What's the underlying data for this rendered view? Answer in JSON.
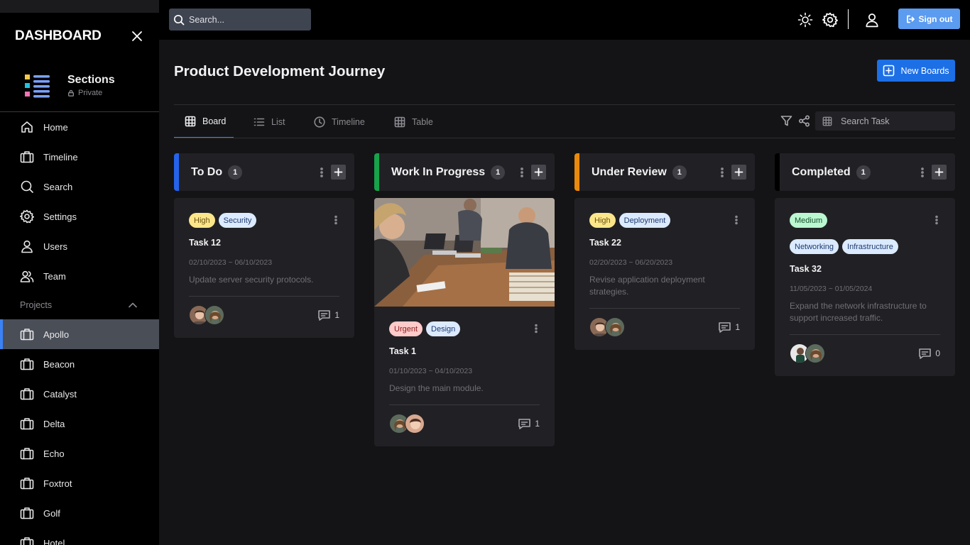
{
  "sidebar": {
    "title": "DASHBOARD",
    "section": {
      "title": "Sections",
      "visibility": "Private"
    },
    "nav": [
      {
        "label": "Home",
        "icon": "home-icon"
      },
      {
        "label": "Timeline",
        "icon": "briefcase-icon"
      },
      {
        "label": "Search",
        "icon": "search-icon"
      },
      {
        "label": "Settings",
        "icon": "gear-icon"
      },
      {
        "label": "Users",
        "icon": "user-icon"
      },
      {
        "label": "Team",
        "icon": "team-icon"
      }
    ],
    "projects_label": "Projects",
    "projects": [
      {
        "label": "Apollo",
        "active": true
      },
      {
        "label": "Beacon"
      },
      {
        "label": "Catalyst"
      },
      {
        "label": "Delta"
      },
      {
        "label": "Echo"
      },
      {
        "label": "Foxtrot"
      },
      {
        "label": "Golf"
      },
      {
        "label": "Hotel"
      }
    ]
  },
  "topbar": {
    "search_placeholder": "Search...",
    "signout_label": "Sign out"
  },
  "main": {
    "title": "Product Development Journey",
    "new_board_label": "New Boards",
    "tabs": [
      {
        "label": "Board",
        "active": true
      },
      {
        "label": "List"
      },
      {
        "label": "Timeline"
      },
      {
        "label": "Table"
      }
    ],
    "task_search_placeholder": "Search Task"
  },
  "columns": [
    {
      "title": "To Do",
      "count": "1",
      "color": "#2563eb",
      "cards": [
        {
          "tags": [
            {
              "label": "High",
              "color": "yellow"
            },
            {
              "label": "Security",
              "color": "blue"
            }
          ],
          "name": "Task 12",
          "dates": "02/10/2023 ~ 06/10/2023",
          "description": "Update server security protocols.",
          "comments": "1"
        }
      ]
    },
    {
      "title": "Work In Progress",
      "count": "1",
      "color": "#16a34a",
      "cards": [
        {
          "image": true,
          "tags": [
            {
              "label": "Urgent",
              "color": "red"
            },
            {
              "label": "Design",
              "color": "blue"
            }
          ],
          "name": "Task 1",
          "dates": "01/10/2023 ~ 04/10/2023",
          "description": "Design the main module.",
          "comments": "1"
        }
      ]
    },
    {
      "title": "Under Review",
      "count": "1",
      "color": "#ea8a0c",
      "cards": [
        {
          "tags": [
            {
              "label": "High",
              "color": "yellow"
            },
            {
              "label": "Deployment",
              "color": "blue"
            }
          ],
          "name": "Task 22",
          "dates": "02/20/2023 ~ 06/20/2023",
          "description": "Revise application deployment strategies.",
          "comments": "1"
        }
      ]
    },
    {
      "title": "Completed",
      "count": "1",
      "color": "#000000",
      "cards": [
        {
          "tags": [
            {
              "label": "Medium",
              "color": "green"
            },
            {
              "label": "Networking",
              "color": "blue"
            },
            {
              "label": "Infrastructure",
              "color": "blue"
            }
          ],
          "name": "Task 32",
          "dates": "11/05/2023 ~ 01/05/2024",
          "description": "Expand the network infrastructure to support increased traffic.",
          "comments": "0"
        }
      ]
    }
  ]
}
